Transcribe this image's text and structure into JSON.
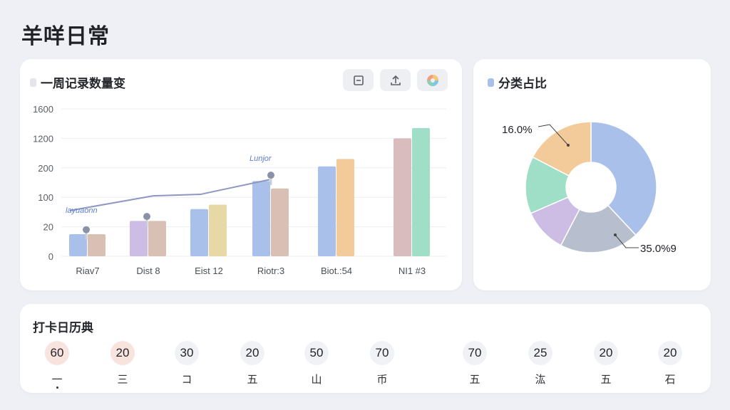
{
  "app": {
    "title": "羊咩日常"
  },
  "bar_panel": {
    "title": "一周记录数量变",
    "toolbar": [
      {
        "name": "table-view-icon",
        "glyph": "⊟"
      },
      {
        "name": "share-icon",
        "glyph": "⇡"
      },
      {
        "name": "palette-icon",
        "glyph": "◕"
      }
    ],
    "annotations": [
      "layuaonn",
      "Lunjor"
    ]
  },
  "pie_panel": {
    "title": "分类占比",
    "labels": [
      "16.0%",
      "35.0%9"
    ]
  },
  "checkin": {
    "title": "打卡日历典",
    "days": [
      {
        "value": "60",
        "label": "一",
        "done": true,
        "marked": true
      },
      {
        "value": "20",
        "label": "三",
        "done": true
      },
      {
        "value": "30",
        "label": "コ",
        "done": false
      },
      {
        "value": "20",
        "label": "五",
        "done": false
      },
      {
        "value": "50",
        "label": "山",
        "done": false
      },
      {
        "value": "70",
        "label": "币",
        "done": false
      },
      {
        "value": "70",
        "label": "五",
        "done": false
      },
      {
        "value": "25",
        "label": "汯",
        "done": false
      },
      {
        "value": "20",
        "label": "五",
        "done": false
      },
      {
        "value": "20",
        "label": "石",
        "done": false
      }
    ]
  },
  "colors": {
    "blue": "#a9c1ea",
    "purple": "#cdbde4",
    "rose": "#d8bcbe",
    "tan": "#d9c0b5",
    "khaki": "#e6d9a6",
    "orange": "#f3cb9a",
    "mint": "#9fdfc8",
    "gray": "#b7bfcf",
    "line": "#8d97c2"
  },
  "chart_data": [
    {
      "type": "bar",
      "title": "一周记录数量变",
      "y_ticks": [
        "1600",
        "1200",
        "200",
        "100",
        "20",
        "0"
      ],
      "categories": [
        "Riav7",
        "Dist 8",
        "Eist 12",
        "Riotr:3",
        "Biot.:54",
        "NI1 #3"
      ],
      "series": [
        {
          "values": [
            0.15,
            0.24,
            0.32,
            0.51,
            0.61,
            0.8
          ],
          "colors": [
            "blue",
            "purple",
            "blue",
            "blue",
            "blue",
            "rose"
          ]
        },
        {
          "values": [
            0.15,
            0.24,
            0.35,
            0.46,
            0.66,
            0.87
          ],
          "colors": [
            "tan",
            "tan",
            "khaki",
            "tan",
            "orange",
            "mint"
          ]
        }
      ],
      "line": {
        "values": [
          0.31,
          0.41,
          0.42,
          0.52
        ],
        "color": "line"
      },
      "points": [
        {
          "x": 0,
          "v": 0.18
        },
        {
          "x": 1,
          "v": 0.27
        },
        {
          "x": 3,
          "v": 0.55
        }
      ],
      "ylim": [
        0,
        1
      ]
    },
    {
      "type": "pie",
      "title": "分类占比",
      "slices": [
        {
          "value": 35,
          "color": "blue"
        },
        {
          "value": 18,
          "color": "gray"
        },
        {
          "value": 10,
          "color": "purple"
        },
        {
          "value": 13,
          "color": "mint"
        },
        {
          "value": 16,
          "color": "orange"
        }
      ],
      "labels": [
        "16.0%",
        "35.0%9"
      ],
      "donut": true
    }
  ]
}
